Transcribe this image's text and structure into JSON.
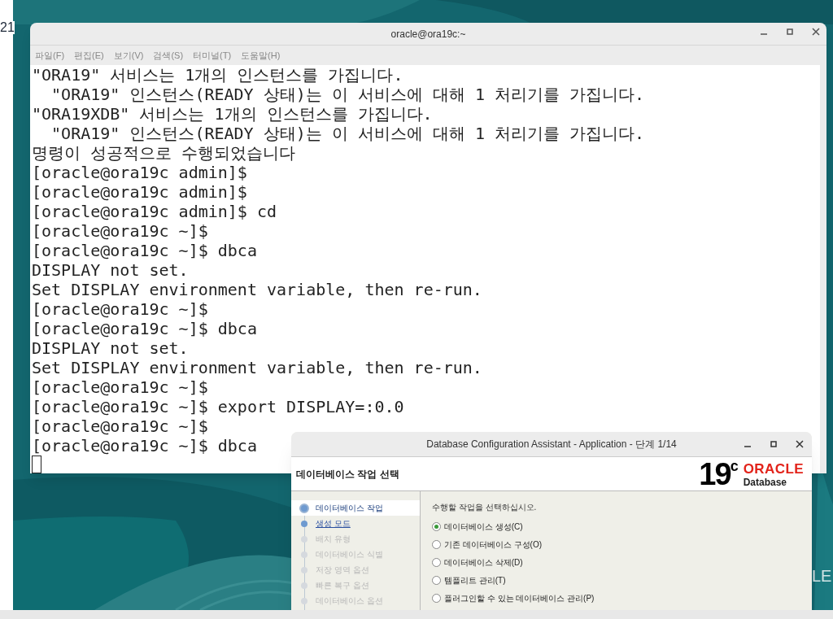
{
  "desktop": {
    "clock_fragment": "21",
    "wallpaper_text": "LE"
  },
  "terminal": {
    "title": "oracle@ora19c:~",
    "menu": [
      "파일(F)",
      "편집(E)",
      "보기(V)",
      "검색(S)",
      "터미널(T)",
      "도움말(H)"
    ],
    "lines": [
      "\"ORA19\" 서비스는 1개의 인스턴스를 가집니다.",
      "  \"ORA19\" 인스턴스(READY 상태)는 이 서비스에 대해 1 처리기를 가집니다.",
      "\"ORA19XDB\" 서비스는 1개의 인스턴스를 가집니다.",
      "  \"ORA19\" 인스턴스(READY 상태)는 이 서비스에 대해 1 처리기를 가집니다.",
      "명령이 성공적으로 수행되었습니다",
      "[oracle@ora19c admin]$",
      "[oracle@ora19c admin]$",
      "[oracle@ora19c admin]$ cd",
      "[oracle@ora19c ~]$",
      "[oracle@ora19c ~]$ dbca",
      "DISPLAY not set.",
      "Set DISPLAY environment variable, then re-run.",
      "[oracle@ora19c ~]$",
      "[oracle@ora19c ~]$ dbca",
      "DISPLAY not set.",
      "Set DISPLAY environment variable, then re-run.",
      "[oracle@ora19c ~]$",
      "[oracle@ora19c ~]$ export DISPLAY=:0.0",
      "[oracle@ora19c ~]$",
      "[oracle@ora19c ~]$ dbca"
    ]
  },
  "dbca": {
    "title": "Database Configuration Assistant - Application - 단계 1/14",
    "header": "데이터베이스 작업 선택",
    "logo": {
      "version": "19",
      "superscript": "c",
      "brand": "ORACLE",
      "product": "Database"
    },
    "steps": [
      {
        "label": "데이터베이스 작업",
        "kind": "current"
      },
      {
        "label": "생성 모드",
        "kind": "link"
      },
      {
        "label": "배치 유형",
        "kind": "disabled"
      },
      {
        "label": "데이터베이스 식별",
        "kind": "disabled"
      },
      {
        "label": "저장 영역 옵션",
        "kind": "disabled"
      },
      {
        "label": "빠른 복구 옵션",
        "kind": "disabled"
      },
      {
        "label": "데이터베이스 옵션",
        "kind": "disabled"
      }
    ],
    "prompt": "수행할 작업을 선택하십시오.",
    "options": [
      {
        "label": "데이터베이스 생성(C)",
        "selected": true
      },
      {
        "label": "기존 데이터베이스 구성(O)",
        "selected": false
      },
      {
        "label": "데이터베이스 삭제(D)",
        "selected": false
      },
      {
        "label": "템플리트 관리(T)",
        "selected": false
      },
      {
        "label": "플러그인할 수 있는 데이터베이스 관리(P)",
        "selected": false
      }
    ]
  }
}
